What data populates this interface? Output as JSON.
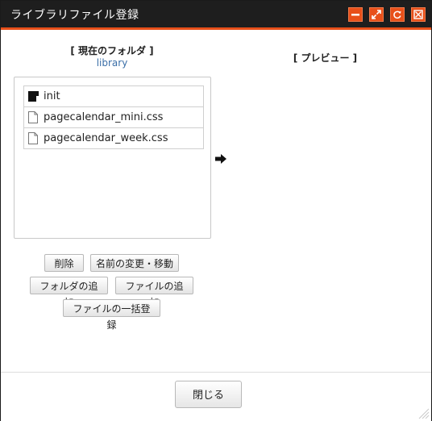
{
  "window": {
    "title": "ライブラリファイル登録",
    "controls": [
      "minimize-icon",
      "maximize-icon",
      "refresh-icon",
      "close-icon"
    ],
    "accent_color": "#e8501a"
  },
  "left_panel": {
    "heading": "[ 現在のフォルダ ]",
    "folder_name": "library",
    "files": [
      {
        "name": "init",
        "icon": "folder-icon"
      },
      {
        "name": "pagecalendar_mini.css",
        "icon": "file-icon"
      },
      {
        "name": "pagecalendar_week.css",
        "icon": "file-icon"
      }
    ]
  },
  "right_panel": {
    "heading": "[ プレビュー ]"
  },
  "actions": {
    "delete": "削除",
    "rename_move": "名前の変更・移動",
    "add_folder": "フォルダの追加",
    "add_file": "ファイルの追加",
    "bulk_register": "ファイルの一括登録"
  },
  "footer": {
    "close": "閉じる"
  }
}
